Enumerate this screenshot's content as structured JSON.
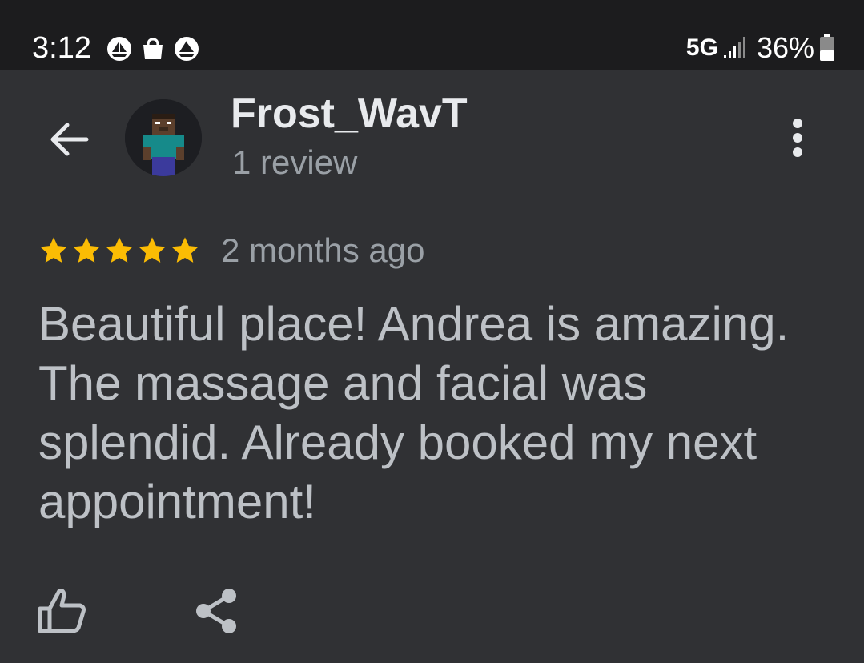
{
  "status_bar": {
    "time": "3:12",
    "network": "5G",
    "battery": "36%",
    "icons": [
      "sailing-notification-icon",
      "shopping-bag-icon",
      "sailing-notification-icon",
      "signal-icon",
      "battery-icon"
    ]
  },
  "header": {
    "reviewer_name": "Frost_WavT",
    "review_count": "1 review",
    "icons": [
      "back-arrow-icon",
      "avatar",
      "more-vert-icon"
    ]
  },
  "review": {
    "rating": 5,
    "rating_max": 5,
    "date": "2 months ago",
    "text": "Beautiful place! Andrea is amazing. The massage and facial was splendid. Already booked my next appointment!"
  },
  "actions": {
    "icons": [
      "thumb-up-icon",
      "share-icon"
    ]
  },
  "colors": {
    "background": "#303134",
    "status_bar": "#1c1c1e",
    "star": "#fbbc04",
    "primary_text": "#e8eaed",
    "secondary_text": "#9aa0a6",
    "body_text": "#bdc1c6"
  }
}
